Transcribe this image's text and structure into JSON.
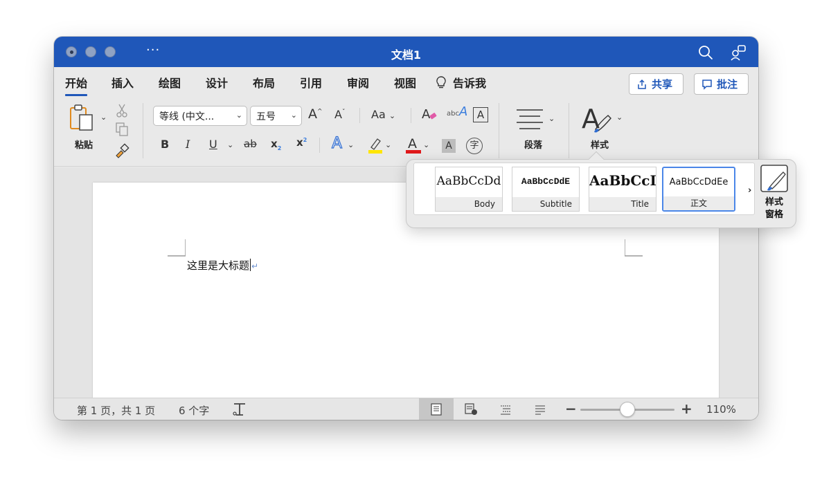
{
  "window": {
    "title": "文档1"
  },
  "tabs": [
    "开始",
    "插入",
    "绘图",
    "设计",
    "布局",
    "引用",
    "审阅",
    "视图"
  ],
  "tell_me": "告诉我",
  "header_buttons": {
    "share": "共享",
    "comments": "批注"
  },
  "ribbon": {
    "paste_label": "粘贴",
    "font_name": "等线 (中文...",
    "font_size": "五号",
    "aa_label": "Aa",
    "abc_label": "abc",
    "paragraph_label": "段落",
    "styles_label": "样式"
  },
  "styles_gallery": {
    "items": [
      {
        "sample": "AaBbCcDd",
        "name": "Body"
      },
      {
        "sample": "AaBbCcDdE",
        "name": "Subtitle"
      },
      {
        "sample": "AaBbCcI",
        "name": "Title"
      },
      {
        "sample": "AaBbCcDdEe",
        "name": "正文"
      }
    ],
    "selected": "正文",
    "pane_label_line1": "样式",
    "pane_label_line2": "窗格"
  },
  "document": {
    "text": "这里是大标题"
  },
  "status": {
    "page_info": "第 1 页，共 1 页",
    "word_count": "6 个字",
    "zoom": "110%",
    "zoom_minus": "−",
    "zoom_plus": "+"
  },
  "colors": {
    "accent": "#1f57b9",
    "highlight": "#ffe600",
    "font_color": "#e0191b"
  },
  "icons": [
    "search-icon",
    "share-people-icon",
    "lightbulb-icon",
    "paste-icon",
    "scissors-icon",
    "copy-icon",
    "format-painter-icon",
    "paragraph-icon",
    "styles-icon"
  ]
}
